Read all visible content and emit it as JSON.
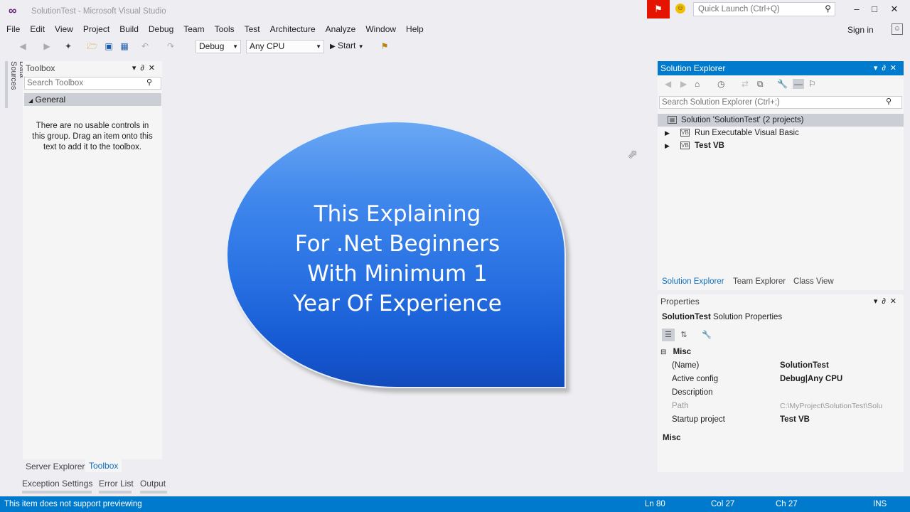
{
  "window": {
    "title": "SolutionTest - Microsoft Visual Studio",
    "quick_launch_placeholder": "Quick Launch (Ctrl+Q)"
  },
  "menu": [
    "File",
    "Edit",
    "View",
    "Project",
    "Build",
    "Debug",
    "Team",
    "Tools",
    "Test",
    "Architecture",
    "Analyze",
    "Window",
    "Help"
  ],
  "account": {
    "signin_label": "Sign in"
  },
  "toolbar": {
    "config_value": "Debug",
    "platform_value": "Any CPU",
    "start_label": "Start"
  },
  "left_strip": {
    "data_sources_label": "Data Sources"
  },
  "toolbox": {
    "title": "Toolbox",
    "search_placeholder": "Search Toolbox",
    "group_label": "General",
    "empty_message": "There are no usable controls in this group. Drag an item onto this text to add it to the toolbox."
  },
  "bottom_tabs": {
    "server_explorer": "Server Explorer",
    "toolbox": "Toolbox",
    "exception_settings": "Exception Settings",
    "error_list": "Error List",
    "output": "Output"
  },
  "bubble": {
    "lines": [
      "This Explaining",
      "For .Net Beginners",
      "With Minimum 1",
      "Year Of Experience"
    ]
  },
  "solution_explorer": {
    "title": "Solution Explorer",
    "search_placeholder": "Search Solution Explorer (Ctrl+;)",
    "tree": [
      {
        "label": "Solution 'SolutionTest' (2 projects)",
        "bold": false
      },
      {
        "label": "Run Executable Visual Basic",
        "bold": false
      },
      {
        "label": "Test VB",
        "bold": true
      }
    ],
    "tabs": [
      "Solution Explorer",
      "Team Explorer",
      "Class View"
    ]
  },
  "properties": {
    "title": "Properties",
    "object_name": "SolutionTest",
    "object_type": "Solution Properties",
    "category": "Misc",
    "rows": [
      {
        "name": "(Name)",
        "value": "SolutionTest"
      },
      {
        "name": "Active config",
        "value": "Debug|Any CPU"
      },
      {
        "name": "Description",
        "value": ""
      },
      {
        "name": "Path",
        "value": "C:\\MyProject\\SolutionTest\\Solu"
      },
      {
        "name": "Startup project",
        "value": "Test VB"
      }
    ],
    "description_title": "Misc"
  },
  "status": {
    "message": "This item does not support previewing",
    "ln": "Ln 80",
    "col": "Col 27",
    "ch": "Ch 27",
    "mode": "INS"
  },
  "colors": {
    "accent": "#007acc",
    "notification": "#e51400",
    "bubble_top": "#6aa8f4",
    "bubble_bottom": "#114bbc"
  }
}
